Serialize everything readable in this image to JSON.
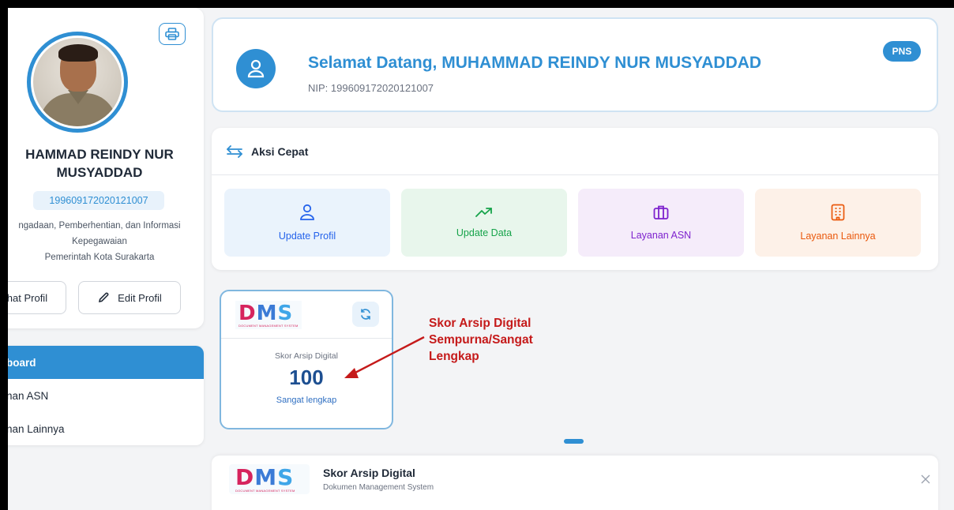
{
  "profile": {
    "name": "HAMMAD REINDY NUR MUSYADDAD",
    "name_line1": "HAMMAD REINDY NUR",
    "name_line2": "MUSYADDAD",
    "nip": "199609172020121007",
    "unit_line1": "ngadaan, Pemberhentian, dan Informasi",
    "unit_line2": "Kepegawaian",
    "unit_line3": "Pemerintah Kota Surakarta",
    "view_button": "ihat Profil",
    "edit_button": "Edit Profil",
    "print_icon": "printer-icon"
  },
  "nav": {
    "items": [
      {
        "label": "board",
        "active": true
      },
      {
        "label": "nan ASN",
        "active": false
      },
      {
        "label": "nan Lainnya",
        "active": false
      }
    ]
  },
  "welcome": {
    "title": "Selamat Datang, MUHAMMAD REINDY NUR MUSYADDAD",
    "nip_label": "NIP: 199609172020121007",
    "badge": "PNS",
    "icon": "user-icon"
  },
  "quick_actions": {
    "title": "Aksi Cepat",
    "icon": "arrows-swap-icon",
    "tiles": [
      {
        "label": "Update Profil",
        "icon": "user-icon",
        "color": "#2563eb"
      },
      {
        "label": "Update Data",
        "icon": "trending-up-icon",
        "color": "#16a34a"
      },
      {
        "label": "Layanan ASN",
        "icon": "briefcase-icon",
        "color": "#7e22ce"
      },
      {
        "label": "Layanan Lainnya",
        "icon": "building-icon",
        "color": "#ea580c"
      }
    ]
  },
  "dms_card": {
    "logo_d": "D",
    "logo_m": "M",
    "logo_s": "S",
    "logo_sub": "DOCUMENT MANAGEMENT SYSTEM",
    "label": "Skor Arsip Digital",
    "score": "100",
    "status": "Sangat lengkap",
    "refresh_icon": "refresh-icon"
  },
  "annotation": {
    "line1": "Skor Arsip Digital",
    "line2": "Sempurna/Sangat",
    "line3": "Lengkap",
    "color": "#c51a1a"
  },
  "modal": {
    "title": "Skor Arsip Digital",
    "subtitle": "Dokumen Management System",
    "close_icon": "close-icon"
  },
  "colors": {
    "primary": "#2f8fd3",
    "score_text": "#1d4f91"
  }
}
